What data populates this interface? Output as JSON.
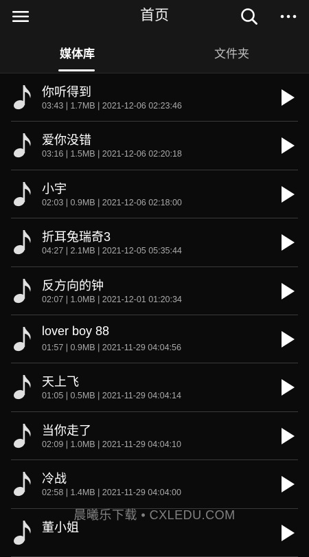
{
  "header": {
    "title": "首页",
    "menu_icon": "menu-icon",
    "search_icon": "search-icon",
    "more_icon": "more-horizontal-icon"
  },
  "tabs": [
    {
      "label": "媒体库",
      "active": true
    },
    {
      "label": "文件夹",
      "active": false
    }
  ],
  "songs": [
    {
      "title": "你听得到",
      "meta": "03:43 | 1.7MB | 2021-12-06 02:23:46"
    },
    {
      "title": "爱你没错",
      "meta": "03:16 | 1.5MB | 2021-12-06 02:20:18"
    },
    {
      "title": "小宇",
      "meta": "02:03 | 0.9MB | 2021-12-06 02:18:00"
    },
    {
      "title": "折耳兔瑞奇3",
      "meta": "04:27 | 2.1MB | 2021-12-05 05:35:44"
    },
    {
      "title": "反方向的钟",
      "meta": "02:07 | 1.0MB | 2021-12-01 01:20:34"
    },
    {
      "title": "lover boy 88",
      "meta": "01:57 | 0.9MB | 2021-11-29 04:04:56"
    },
    {
      "title": "天上飞",
      "meta": "01:05 | 0.5MB | 2021-11-29 04:04:14"
    },
    {
      "title": "当你走了",
      "meta": "02:09 | 1.0MB | 2021-11-29 04:04:10"
    },
    {
      "title": "冷战",
      "meta": "02:58 | 1.4MB | 2021-11-29 04:04:00"
    },
    {
      "title": "董小姐",
      "meta": ""
    }
  ],
  "watermark": "晨曦乐下载 • CXLEDU.COM",
  "colors": {
    "background": "#0b0b0b",
    "bar": "#171717",
    "divider": "#3a3a3a",
    "text_primary": "#ffffff",
    "text_secondary": "#a9a9a9"
  }
}
